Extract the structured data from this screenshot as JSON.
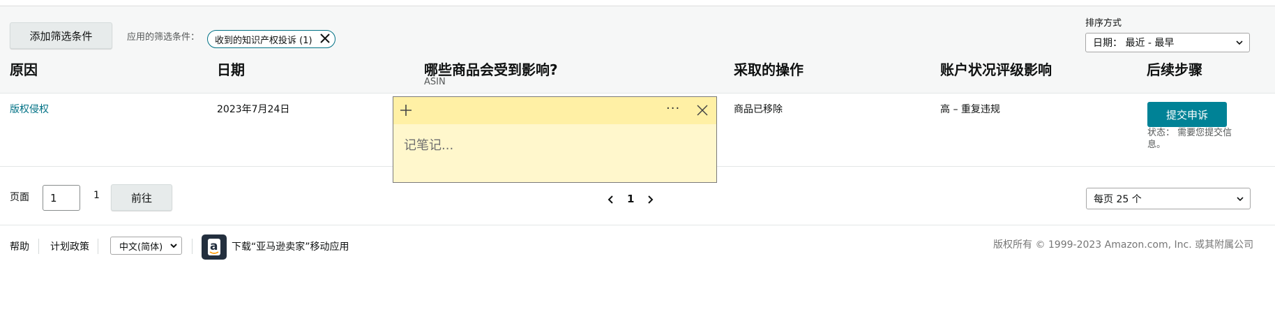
{
  "filters": {
    "add_filter_label": "添加筛选条件",
    "applied_label": "应用的筛选条件：",
    "chip_label": "收到的知识产权投诉 (1)"
  },
  "sort": {
    "label": "排序方式",
    "value": "日期：  最近 - 最早"
  },
  "table": {
    "headers": {
      "reason": "原因",
      "date": "日期",
      "affected": "哪些商品会受到影响?",
      "affected_sub": "ASIN",
      "action": "采取的操作",
      "impact": "账户状况评级影响",
      "next": "后续步骤"
    },
    "row": {
      "reason": "版权侵权",
      "date": "2023年7月24日",
      "action": "商品已移除",
      "impact": "高 – 重复违规",
      "appeal_button": "提交申诉",
      "status_line1": "状态：  需要您提交信",
      "status_line2": "息。"
    }
  },
  "sticky_note": {
    "placeholder": "记笔记...",
    "more_glyph": "···"
  },
  "pagination": {
    "page_label": "页面",
    "page_value": "1",
    "total": "1",
    "go_label": "前往",
    "current": "1",
    "per_page": "每页 25 个"
  },
  "footer": {
    "help": "帮助",
    "policies": "计划政策",
    "language": "中文(简体)",
    "download_app": "下载“亚马逊卖家”移动应用",
    "app_icon_letter": "a",
    "copyright": "版权所有 © 1999-2023 Amazon.com, Inc. 或其附属公司"
  },
  "colors": {
    "teal": "#008296",
    "link": "#007185",
    "sticky_body": "#fff7cc",
    "sticky_bar": "#fff0a5"
  },
  "icons": [
    "close-icon",
    "chevron-down-icon",
    "plus-icon",
    "more-icon",
    "chevron-left-icon",
    "chevron-right-icon",
    "amazon-app-icon"
  ]
}
